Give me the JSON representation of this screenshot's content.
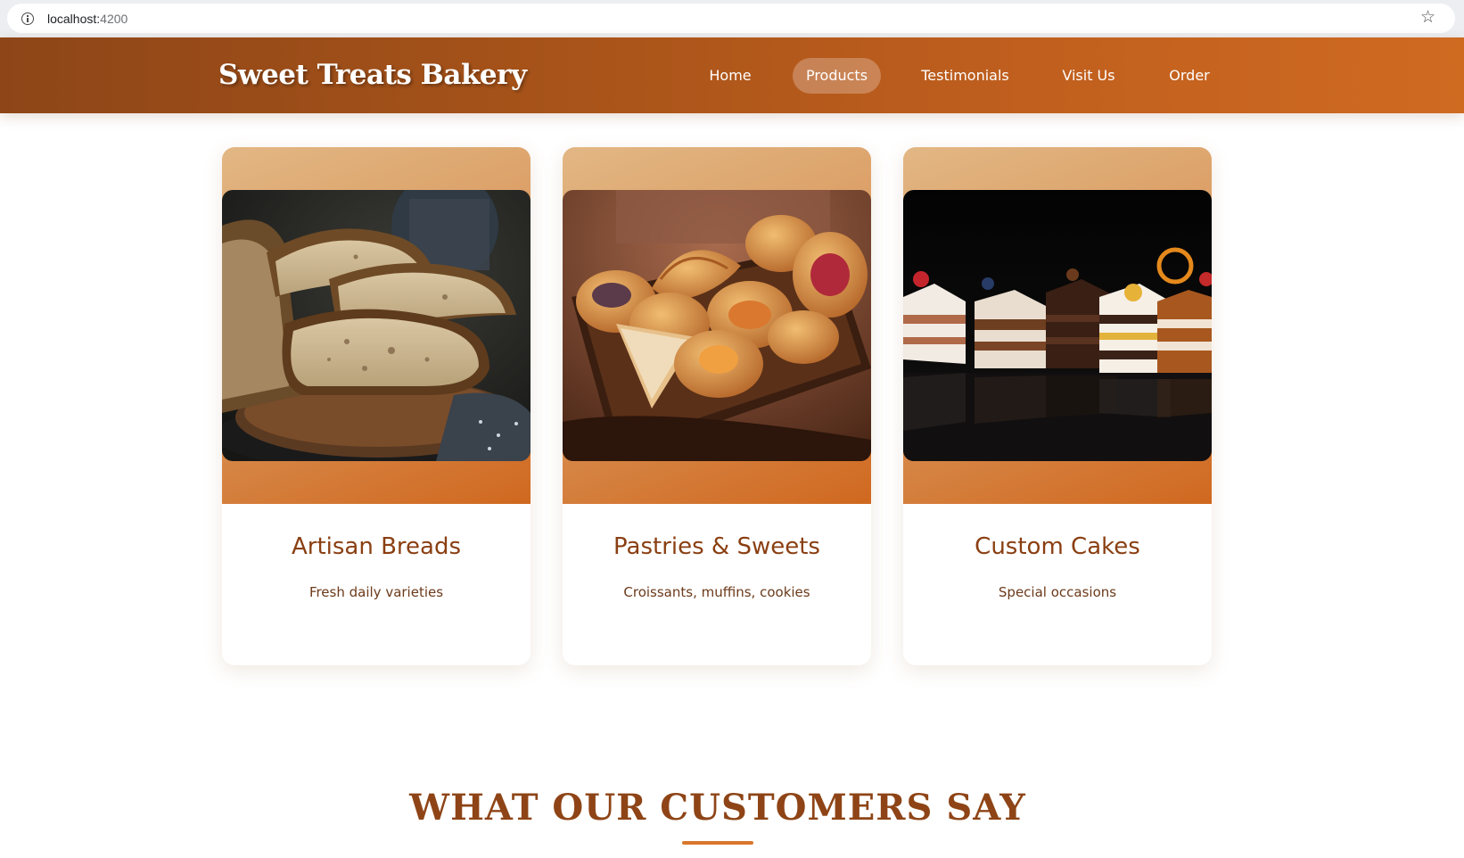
{
  "browser": {
    "url_host": "localhost:",
    "url_port": "4200",
    "info_icon": "info-icon",
    "bookmark_icon": "star-icon"
  },
  "header": {
    "brand": "Sweet Treats Bakery",
    "nav": [
      {
        "label": "Home",
        "active": false
      },
      {
        "label": "Products",
        "active": true
      },
      {
        "label": "Testimonials",
        "active": false
      },
      {
        "label": "Visit Us",
        "active": false
      },
      {
        "label": "Order",
        "active": false
      }
    ]
  },
  "products": [
    {
      "title": "Artisan Breads",
      "subtitle": "Fresh daily varieties",
      "image": "sliced-sourdough-bread-photo"
    },
    {
      "title": "Pastries & Sweets",
      "subtitle": "Croissants, muffins, cookies",
      "image": "pastry-basket-photo"
    },
    {
      "title": "Custom Cakes",
      "subtitle": "Special occasions",
      "image": "cake-slices-photo"
    }
  ],
  "testimonials": {
    "heading": "WHAT OUR CUSTOMERS SAY"
  },
  "colors": {
    "header_start": "#8e4618",
    "header_end": "#cf6a21",
    "card_title": "#8a3f12",
    "accent": "#d9762b"
  }
}
